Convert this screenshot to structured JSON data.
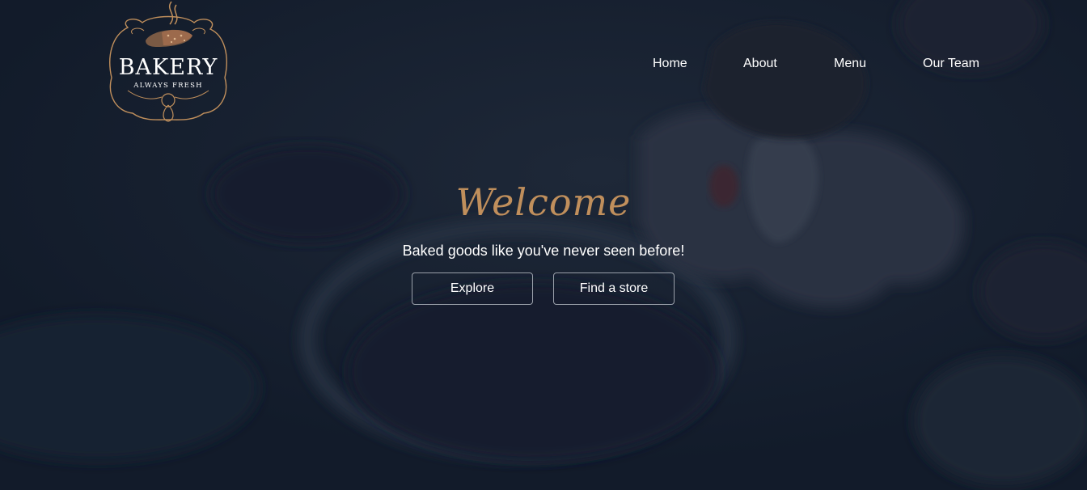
{
  "logo": {
    "name": "BAKERY",
    "tagline": "ALWAYS FRESH",
    "accent_color": "#c08f5c"
  },
  "nav": {
    "items": [
      {
        "label": "Home"
      },
      {
        "label": "About"
      },
      {
        "label": "Menu"
      },
      {
        "label": "Our Team"
      }
    ]
  },
  "hero": {
    "title": "Welcome",
    "subtitle": "Baked goods like you've never seen before!",
    "buttons": [
      {
        "label": "Explore"
      },
      {
        "label": "Find a store"
      }
    ],
    "background_color": "#131d2d",
    "title_color": "#c08f5c"
  }
}
